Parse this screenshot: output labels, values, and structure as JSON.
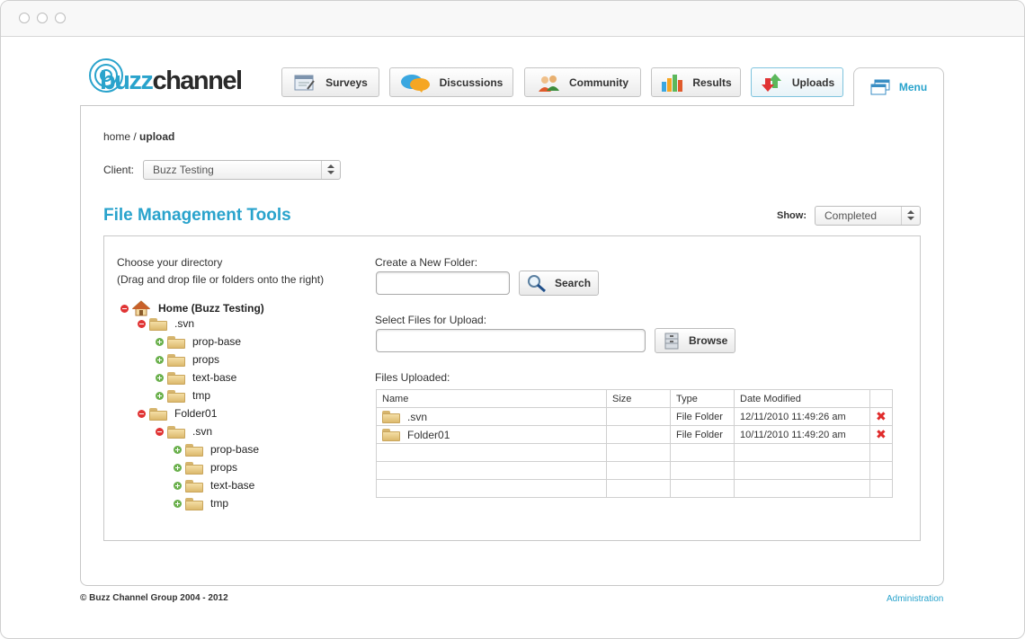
{
  "nav": {
    "tabs": [
      {
        "label": "Surveys",
        "icon": "survey-icon"
      },
      {
        "label": "Discussions",
        "icon": "speech-bubbles-icon"
      },
      {
        "label": "Community",
        "icon": "people-icon"
      },
      {
        "label": "Results",
        "icon": "bar-chart-icon"
      },
      {
        "label": "Uploads",
        "icon": "up-down-arrows-icon"
      }
    ],
    "menu_label": "Menu",
    "active_tab": "Uploads"
  },
  "logo": {
    "part1": "buzz",
    "part2": "channel"
  },
  "breadcrumb": {
    "home": "home",
    "sep": " / ",
    "current": "upload"
  },
  "client": {
    "label": "Client:",
    "value": "Buzz Testing"
  },
  "section_title": "File Management Tools",
  "show": {
    "label": "Show:",
    "value": "Completed"
  },
  "directory": {
    "line1": "Choose your directory",
    "line2": "(Drag and drop file or folders onto the right)",
    "root": "Home (Buzz Testing)",
    "items": [
      {
        "label": ".svn"
      },
      {
        "label": "prop-base"
      },
      {
        "label": "props"
      },
      {
        "label": "text-base"
      },
      {
        "label": "tmp"
      },
      {
        "label": "Folder01"
      },
      {
        "label": ".svn"
      },
      {
        "label": "prop-base"
      },
      {
        "label": "props"
      },
      {
        "label": "text-base"
      },
      {
        "label": "tmp"
      }
    ]
  },
  "new_folder": {
    "label": "Create a New Folder:",
    "value": "",
    "button": "Search"
  },
  "upload": {
    "label": "Select Files for Upload:",
    "value": "",
    "button": "Browse"
  },
  "files": {
    "label": "Files Uploaded:",
    "headers": [
      "Name",
      "Size",
      "Type",
      "Date Modified"
    ],
    "rows": [
      {
        "name": ".svn",
        "size": "",
        "type": "File Folder",
        "date": "12/11/2010 11:49:26 am"
      },
      {
        "name": "Folder01",
        "size": "",
        "type": "File Folder",
        "date": "10/11/2010 11:49:20 am"
      }
    ]
  },
  "footer": {
    "copyright": "© Buzz Channel Group 2004 - 2012",
    "admin": "Administration"
  },
  "colors": {
    "accent": "#29a3cc",
    "delete": "#e02b2b"
  }
}
